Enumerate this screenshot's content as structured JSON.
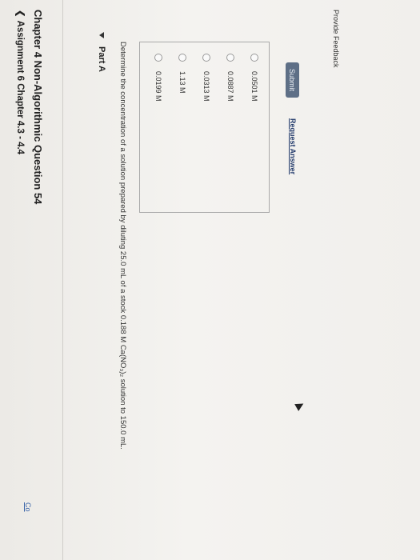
{
  "header": {
    "breadcrumb": "Assignment 6 Chapter 4.3 - 4.4",
    "question_title": "Chapter 4 Non-Algorithmic Question 54",
    "corner_link": "Co"
  },
  "part": {
    "title": "Part A",
    "prompt": "Determine the concentration of a solution prepared by diluting 25.0 mL of a stock 0.188 M Ca(NO₃)₂ solution to 150.0 mL.",
    "choices": [
      {
        "label": "0.0501 M",
        "selected": false
      },
      {
        "label": "0.0887 M",
        "selected": false
      },
      {
        "label": "0.0313 M",
        "selected": false
      },
      {
        "label": "1.13 M",
        "selected": false
      },
      {
        "label": "0.0199 M",
        "selected": false
      }
    ]
  },
  "actions": {
    "submit_label": "Submit",
    "request_answer_label": "Request Answer"
  },
  "footer": {
    "feedback_label": "Provide Feedback"
  },
  "colors": {
    "submit_bg": "#5e6f86",
    "link": "#223a6b"
  }
}
